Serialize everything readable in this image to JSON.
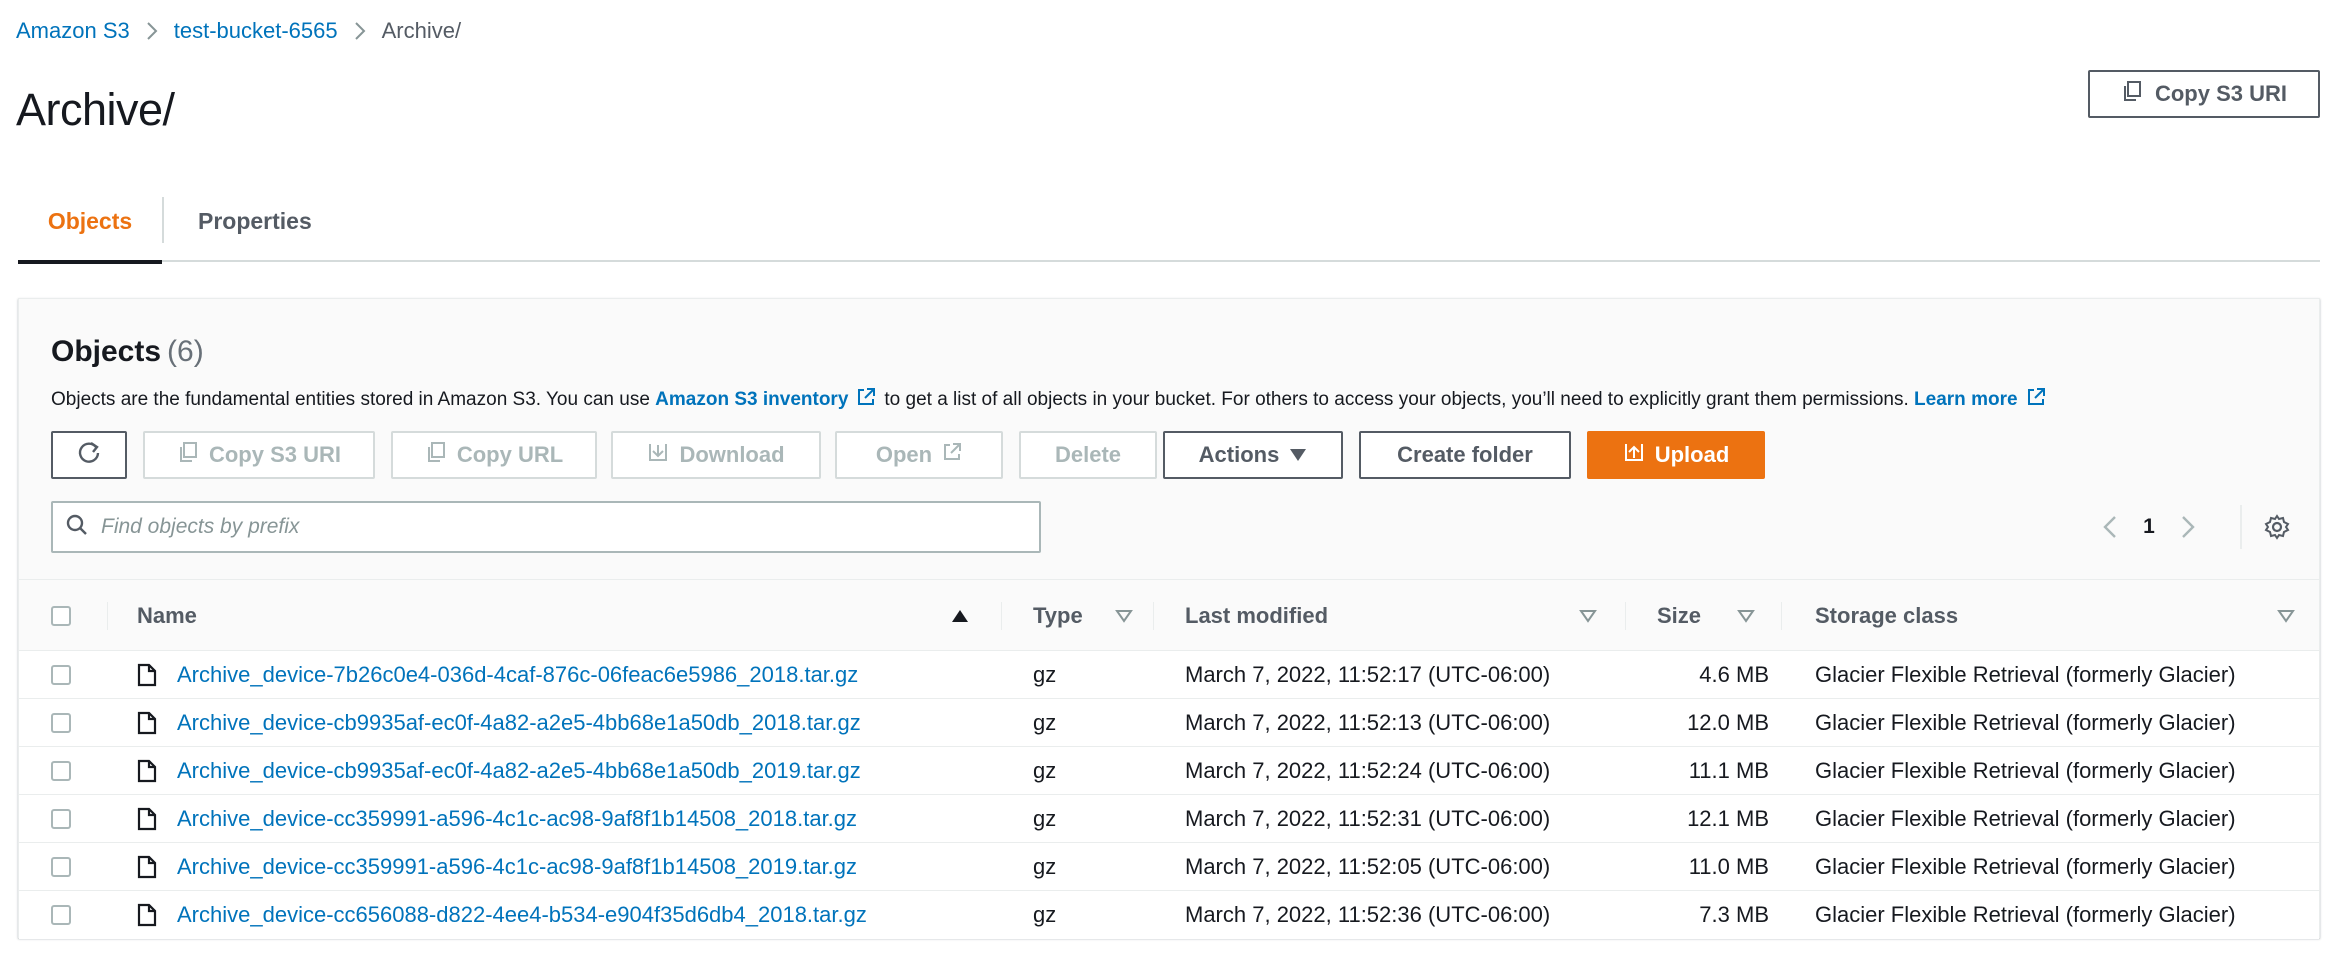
{
  "breadcrumb": {
    "items": [
      "Amazon S3",
      "test-bucket-6565",
      "Archive/"
    ]
  },
  "page": {
    "title": "Archive/",
    "copy_uri_label": "Copy S3 URI"
  },
  "tabs": [
    {
      "label": "Objects",
      "active": true
    },
    {
      "label": "Properties",
      "active": false
    }
  ],
  "objects_panel": {
    "title": "Objects",
    "count": "(6)",
    "description_prefix": "Objects are the fundamental entities stored in Amazon S3. You can use",
    "inventory_link": "Amazon S3 inventory",
    "description_middle": "to get a list of all objects in your bucket. For others to access your objects, you’ll need to explicitly grant them permissions.",
    "learn_more": "Learn more"
  },
  "toolbar": {
    "copy_s3_uri": "Copy S3 URI",
    "copy_url": "Copy URL",
    "download": "Download",
    "open": "Open",
    "delete": "Delete",
    "actions": "Actions",
    "create_folder": "Create folder",
    "upload": "Upload"
  },
  "search": {
    "placeholder": "Find objects by prefix",
    "value": ""
  },
  "pagination": {
    "current_page": "1"
  },
  "table": {
    "columns": [
      "Name",
      "Type",
      "Last modified",
      "Size",
      "Storage class"
    ],
    "rows": [
      {
        "name": "Archive_device-7b26c0e4-036d-4caf-876c-06feac6e5986_2018.tar.gz",
        "type": "gz",
        "last_modified": "March 7, 2022, 11:52:17 (UTC-06:00)",
        "size": "4.6 MB",
        "storage_class": "Glacier Flexible Retrieval (formerly Glacier)"
      },
      {
        "name": "Archive_device-cb9935af-ec0f-4a82-a2e5-4bb68e1a50db_2018.tar.gz",
        "type": "gz",
        "last_modified": "March 7, 2022, 11:52:13 (UTC-06:00)",
        "size": "12.0 MB",
        "storage_class": "Glacier Flexible Retrieval (formerly Glacier)"
      },
      {
        "name": "Archive_device-cb9935af-ec0f-4a82-a2e5-4bb68e1a50db_2019.tar.gz",
        "type": "gz",
        "last_modified": "March 7, 2022, 11:52:24 (UTC-06:00)",
        "size": "11.1 MB",
        "storage_class": "Glacier Flexible Retrieval (formerly Glacier)"
      },
      {
        "name": "Archive_device-cc359991-a596-4c1c-ac98-9af8f1b14508_2018.tar.gz",
        "type": "gz",
        "last_modified": "March 7, 2022, 11:52:31 (UTC-06:00)",
        "size": "12.1 MB",
        "storage_class": "Glacier Flexible Retrieval (formerly Glacier)"
      },
      {
        "name": "Archive_device-cc359991-a596-4c1c-ac98-9af8f1b14508_2019.tar.gz",
        "type": "gz",
        "last_modified": "March 7, 2022, 11:52:05 (UTC-06:00)",
        "size": "11.0 MB",
        "storage_class": "Glacier Flexible Retrieval (formerly Glacier)"
      },
      {
        "name": "Archive_device-cc656088-d822-4ee4-b534-e904f35d6db4_2018.tar.gz",
        "type": "gz",
        "last_modified": "March 7, 2022, 11:52:36 (UTC-06:00)",
        "size": "7.3 MB",
        "storage_class": "Glacier Flexible Retrieval (formerly Glacier)"
      }
    ]
  },
  "colors": {
    "link": "#0073bb",
    "accent": "#ec7211",
    "text": "#16191f",
    "muted": "#545b64",
    "disabled": "#aab7b8"
  }
}
